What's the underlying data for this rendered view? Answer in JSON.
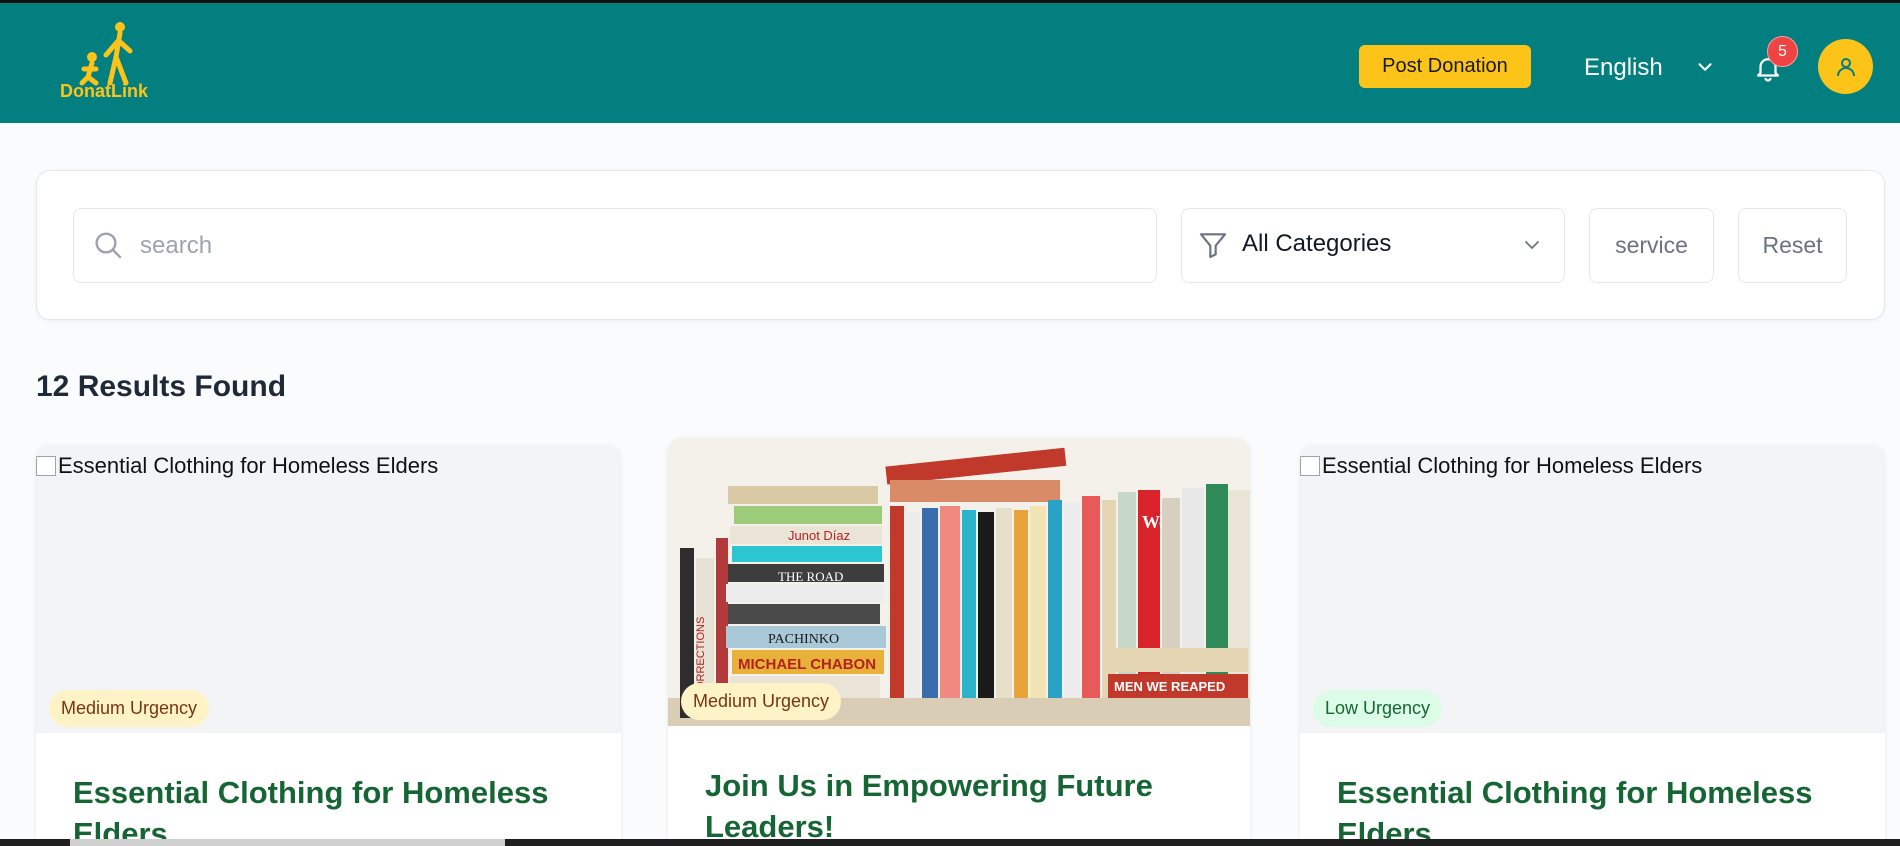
{
  "header": {
    "logo_text": "DonatLink",
    "post_donation_label": "Post Donation",
    "language": "English",
    "notification_count": "5",
    "brand_color": "#037f80",
    "accent_color": "#fcc419"
  },
  "filters": {
    "search_placeholder": "search",
    "category_value": "All Categories",
    "service_label": "service",
    "reset_label": "Reset"
  },
  "results_label": "12 Results Found",
  "cards": [
    {
      "image_alt": "Essential Clothing for Homeless Elders",
      "urgency": "Medium Urgency",
      "title": "Essential Clothing for Homeless Elders",
      "image_loaded": false
    },
    {
      "image_alt": "Join Us in Empowering Future Leaders!",
      "urgency": "Medium Urgency",
      "title": "Join Us in Empowering Future Leaders!",
      "image_loaded": true,
      "book_spines": [
        "MICHAEL CHABON",
        "PACHINKO",
        "THE ROAD",
        "Junot Díaz",
        "Wolf",
        "CORRECTIONS",
        "MEN WE REAPED"
      ]
    },
    {
      "image_alt": "Essential Clothing for Homeless Elders",
      "urgency": "Low Urgency",
      "title": "Essential Clothing for Homeless Elders",
      "image_loaded": false
    }
  ]
}
